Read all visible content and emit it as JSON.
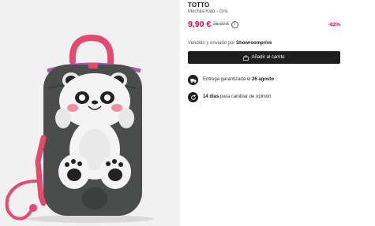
{
  "product": {
    "brand": "TOTTO",
    "name": "Mochila Kido - Gris",
    "price": "9,90 €",
    "old_price": "26,00 €",
    "discount": "-62%"
  },
  "seller": {
    "prefix": "Vendido y enviado por",
    "name": "Showroomprive"
  },
  "actions": {
    "add_to_cart": "Añadir al carrito"
  },
  "features": {
    "delivery": {
      "text": "Entrega garantizada el",
      "date": "26 agosto",
      "icon": "truck-icon"
    },
    "returns": {
      "days": "14 días",
      "text": "para cambiar de opinión",
      "icon": "return-arrow-icon"
    }
  },
  "colors": {
    "accent": "#e6004f",
    "button": "#1e1e1e",
    "backpack": "#4a4d4c",
    "strap": "#e34a6f"
  }
}
